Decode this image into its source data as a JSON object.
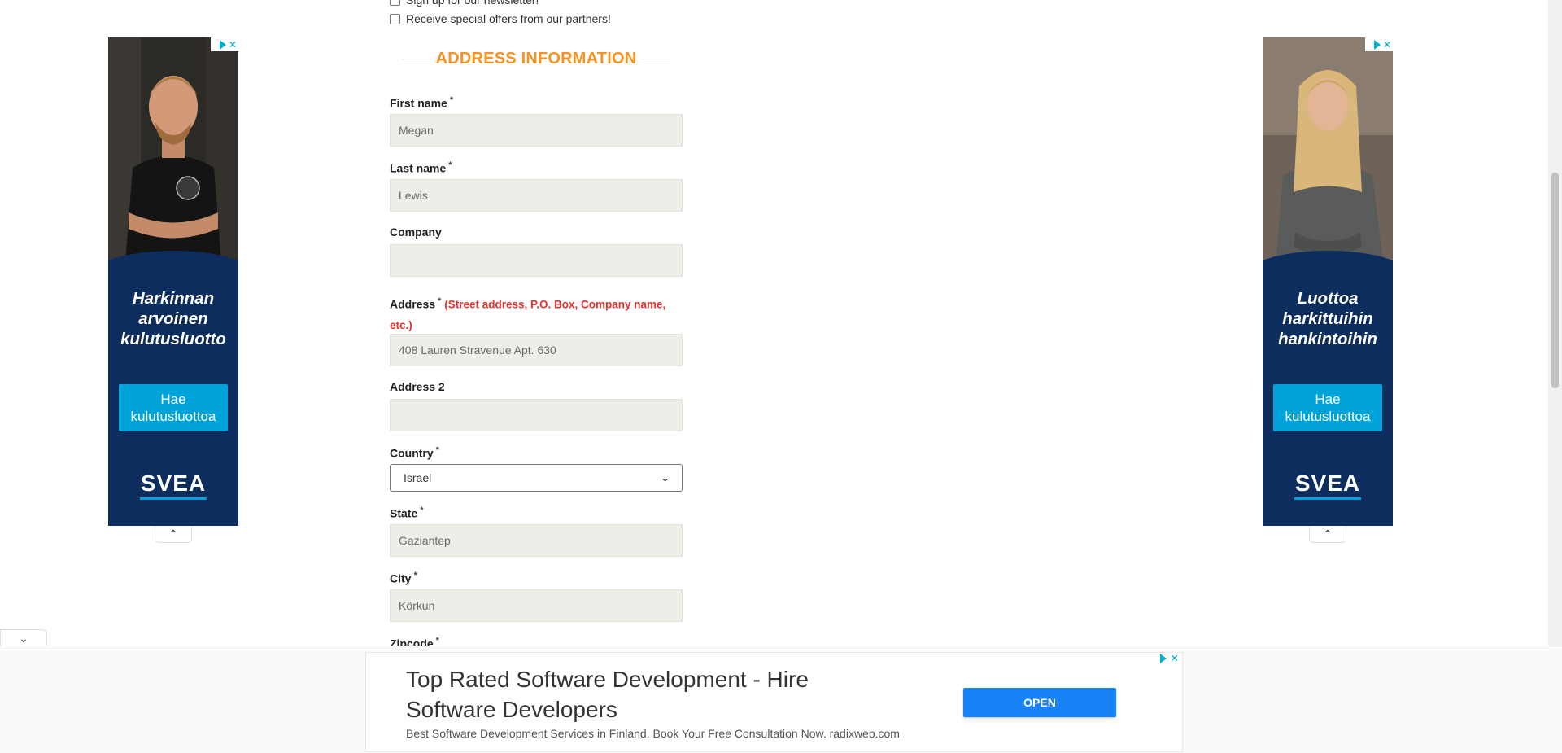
{
  "checkboxes": [
    {
      "label": "Sign up for our newsletter!",
      "checked": false
    },
    {
      "label": "Receive special offers from our partners!",
      "checked": false
    }
  ],
  "section_title": "ADDRESS INFORMATION",
  "required_mark": "*",
  "fields": {
    "first_name": {
      "label": "First name",
      "value": "Megan"
    },
    "last_name": {
      "label": "Last name",
      "value": "Lewis"
    },
    "company": {
      "label": "Company",
      "value": ""
    },
    "address": {
      "label": "Address",
      "note": "(Street address, P.O. Box, Company name,",
      "note2": "etc.)",
      "value": "408 Lauren Stravenue Apt. 630"
    },
    "address2": {
      "label": "Address 2",
      "value": ""
    },
    "country": {
      "label": "Country",
      "value": "Israel"
    },
    "state": {
      "label": "State",
      "value": "Gaziantep"
    },
    "city": {
      "label": "City",
      "value": "Körkun"
    },
    "zipcode": {
      "label": "Zipcode"
    }
  },
  "left_ad": {
    "headline_lines": [
      "Harkinnan",
      "arvoinen",
      "kulutusluotto"
    ],
    "cta_lines": [
      "Hae",
      "kulutusluottoa"
    ],
    "brand": "SVEA"
  },
  "right_ad": {
    "headline_lines": [
      "Luottoa",
      "harkittuihin",
      "hankintoihin"
    ],
    "cta_lines": [
      "Hae",
      "kulutusluottoa"
    ],
    "brand": "SVEA"
  },
  "bottom_ad": {
    "headline": "Top Rated Software Development - Hire Software Developers",
    "description": "Best Software Development Services in Finland. Book Your Free Consultation Now. radixweb.com",
    "cta": "OPEN"
  },
  "icons": {
    "collapse_up": "chevron-up-icon",
    "collapse_down": "chevron-down-icon",
    "close": "close-icon",
    "adchoices": "adchoices-icon"
  },
  "colors": {
    "section_title": "#f7931e",
    "field_bg": "#efede7",
    "required_note": "#e8322f",
    "ad_navy": "#0d2d5e",
    "ad_cyan": "#00a3d9",
    "open_button": "#1a82f7"
  }
}
